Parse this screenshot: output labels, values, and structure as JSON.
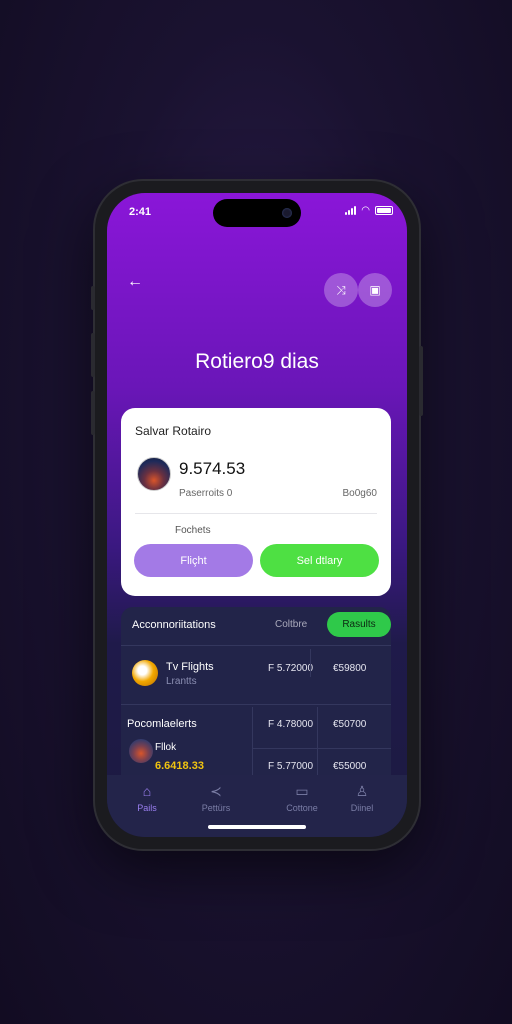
{
  "status": {
    "time": "2:41"
  },
  "header": {
    "back_icon": "back-arrow-icon",
    "action1_icon": "shuffle-icon",
    "action2_icon": "bag-icon",
    "title": "Rotiero9 dias"
  },
  "summary_card": {
    "title": "Salvar Rotairo",
    "amount": "9.574.53",
    "sub_left": "Paserroits 0",
    "sub_right": "Bo0g60",
    "section_label": "Fochets",
    "button_left": "Fliçht",
    "button_right": "Sel dtlary"
  },
  "list_panel": {
    "title": "Acconnoriitations",
    "link": "Coltbre",
    "badge": "Rasults",
    "rows": [
      {
        "title": "Tv Flights",
        "subtitle": "Lrantts",
        "col1": "F 5.72000",
        "col2": "€59800"
      },
      {
        "title": "Pocomlaelerts",
        "col1": "F 4.78000",
        "col2": "€50700"
      },
      {
        "title": "Fllok",
        "subtitle": "6.6418.33",
        "col1": "F 5.77000",
        "col2": "€55000"
      }
    ]
  },
  "tabbar": {
    "items": [
      {
        "label": "Pails",
        "icon": "home-icon"
      },
      {
        "label": "Pettürs",
        "icon": "share-icon"
      },
      {
        "label": "Cottone",
        "icon": "monitor-icon"
      },
      {
        "label": "Diinel",
        "icon": "user-icon"
      }
    ]
  },
  "colors": {
    "accent_purple": "#8a16d8",
    "pill_purple": "#a37ae6",
    "pill_green": "#4ee043",
    "badge_green": "#2fc94a",
    "panel_dark": "#222449"
  }
}
